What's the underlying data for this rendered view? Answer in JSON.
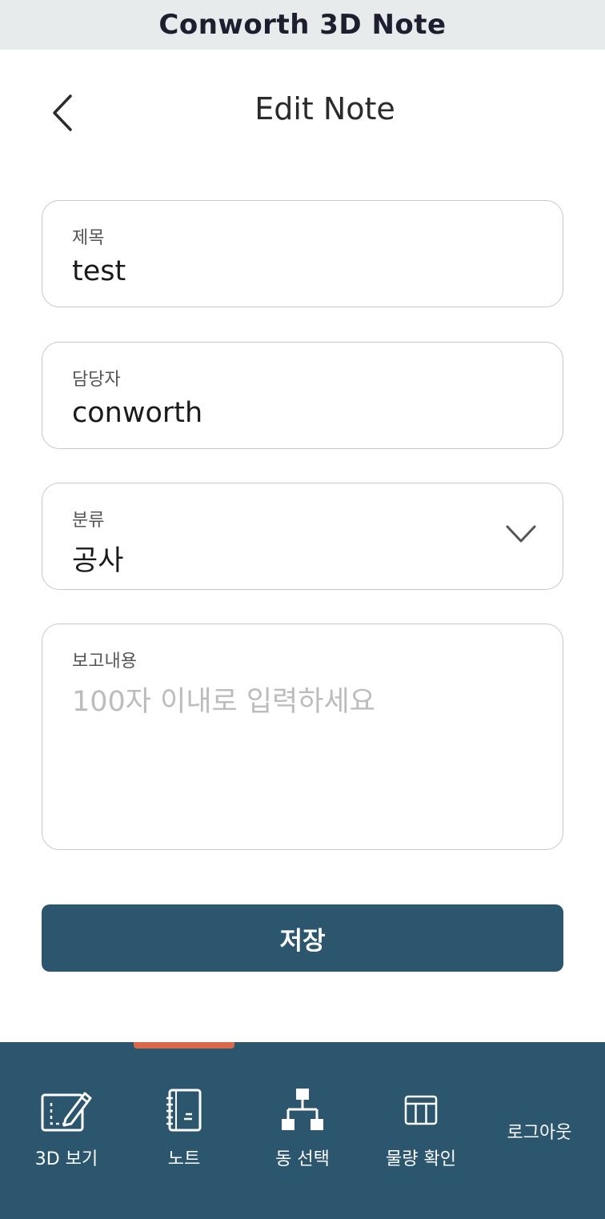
{
  "app": {
    "title": "Conworth 3D Note"
  },
  "header": {
    "title": "Edit Note",
    "back_icon": "chevron-left-icon"
  },
  "form": {
    "title_field": {
      "label": "제목",
      "value": "test"
    },
    "assignee_field": {
      "label": "담당자",
      "value": "conworth"
    },
    "category_field": {
      "label": "분류",
      "value": "공사",
      "icon": "chevron-down-icon"
    },
    "report_field": {
      "label": "보고내용",
      "value": "",
      "placeholder": "100자 이내로 입력하세요"
    }
  },
  "save_button": {
    "label": "저장"
  },
  "nav": {
    "active_index": 1,
    "accent_color": "#d9694a",
    "background_color": "#2b566d",
    "items": [
      {
        "label": "3D 보기",
        "icon": "blueprint-edit-icon"
      },
      {
        "label": "노트",
        "icon": "notebook-icon"
      },
      {
        "label": "동 선택",
        "icon": "hierarchy-icon"
      },
      {
        "label": "물량 확인",
        "icon": "table-icon"
      }
    ],
    "logout_label": "로그아웃"
  }
}
